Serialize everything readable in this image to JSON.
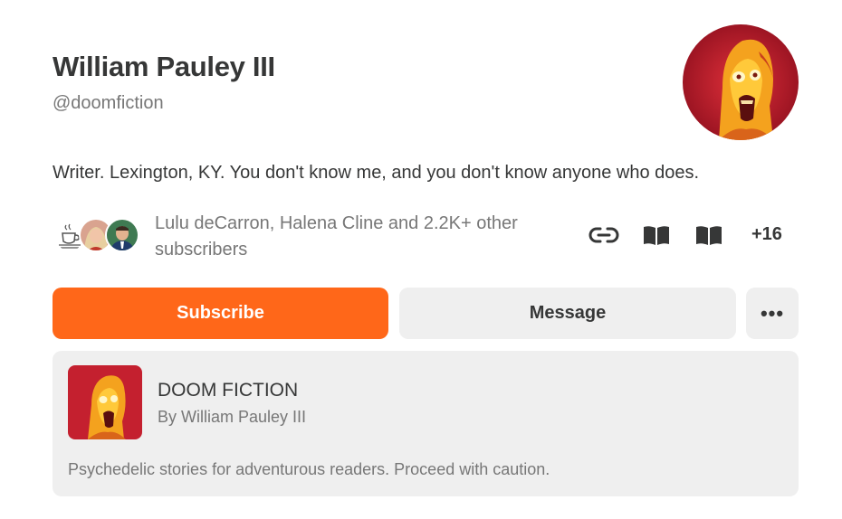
{
  "profile": {
    "name": "William Pauley III",
    "handle": "@doomfiction",
    "bio": "Writer. Lexington, KY. You don't know me, and you don't know anyone who does."
  },
  "subscribers": {
    "text": "Lulu deCarron, Halena Cline and 2.2K+ other subscribers"
  },
  "links": {
    "icons": [
      "link-icon",
      "book-icon",
      "book-icon"
    ],
    "more_count": "+16"
  },
  "actions": {
    "subscribe_label": "Subscribe",
    "message_label": "Message",
    "more_label": "•••"
  },
  "publication": {
    "title": "DOOM FICTION",
    "byline": "By William Pauley III",
    "description": "Psychedelic stories for adventurous readers. Proceed with caution."
  },
  "colors": {
    "accent": "#ff6719",
    "text": "#363737",
    "muted": "#777777",
    "card_bg": "#efefef"
  }
}
